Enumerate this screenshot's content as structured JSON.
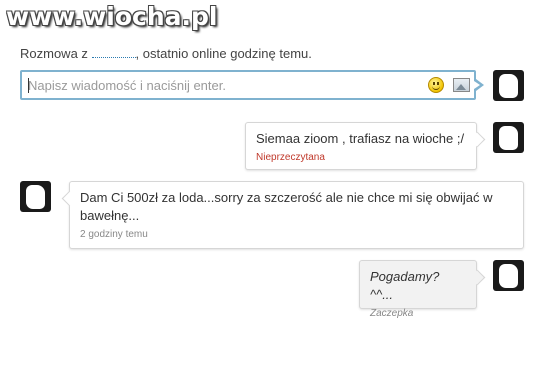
{
  "watermark": "www.wiocha.pl",
  "header": {
    "prefix": "Rozmowa z",
    "name": "",
    "suffix": ", ostatnio online godzinę temu."
  },
  "compose": {
    "placeholder": "Napisz wiadomość i naciśnij enter."
  },
  "messages": [
    {
      "side": "right",
      "text": "Siemaa zioom , trafiasz na wioche ;/",
      "meta": "Nieprzeczytana"
    },
    {
      "side": "left",
      "text": "Dam Ci 500zł za loda...sorry za szczerość ale nie chce mi się obwijać w bawełnę...",
      "meta": "2 godziny temu"
    },
    {
      "side": "right",
      "text": "Pogadamy? ^^...",
      "meta": "Zaczepka"
    }
  ],
  "colors": {
    "unread": "#c0392b",
    "accent": "#7fb2cf",
    "link": "#2a7ab0"
  },
  "icons": [
    "smiley-icon",
    "image-icon"
  ]
}
